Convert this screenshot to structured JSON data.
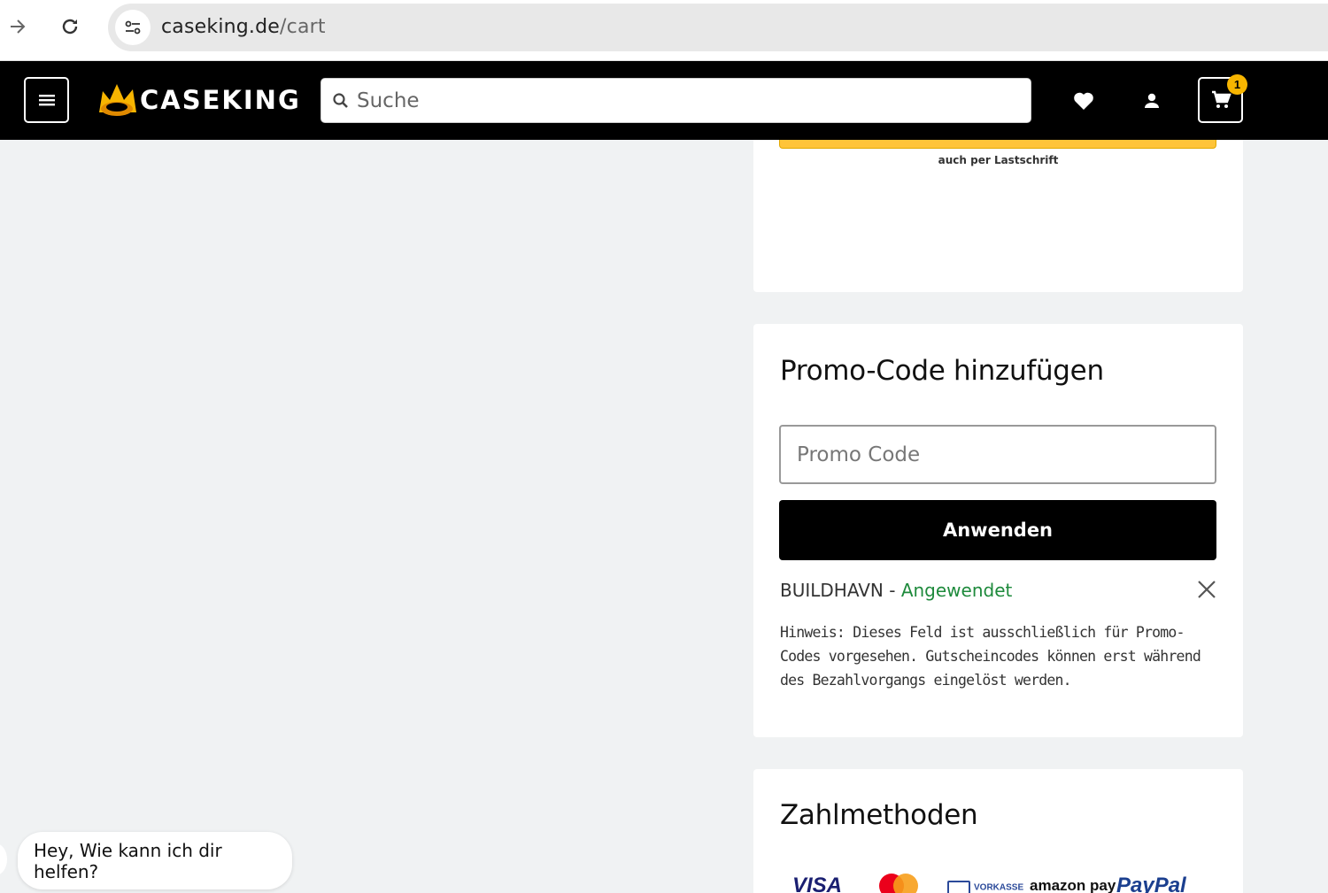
{
  "browser": {
    "url_host": "caseking.de",
    "url_path": "/cart"
  },
  "header": {
    "logo_text": "CASEKING",
    "search_placeholder": "Suche",
    "cart_count": "1"
  },
  "paypal": {
    "subtext": "auch per Lastschrift"
  },
  "promo": {
    "title": "Promo-Code hinzufügen",
    "input_placeholder": "Promo Code",
    "apply_label": "Anwenden",
    "applied_code": "BUILDHAVN",
    "separator": " - ",
    "applied_status": "Angewendet",
    "hint": "Hinweis: Dieses Feld ist ausschließlich für Promo-Codes vorgesehen. Gutscheincodes können erst während des Bezahlvorgangs eingelöst werden."
  },
  "payment": {
    "title": "Zahlmethoden",
    "methods": [
      "VISA",
      "Mastercard",
      "VORKASSE",
      "amazon pay",
      "PayPal"
    ]
  },
  "chat": {
    "greeting": "Hey, Wie kann ich dir helfen?"
  },
  "colors": {
    "brand_yellow": "#f7b500",
    "applied_green": "#1e8a3c",
    "paypal_yellow": "#ffc439"
  }
}
